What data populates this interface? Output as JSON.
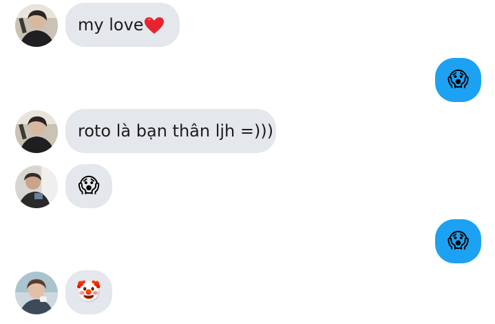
{
  "messages": [
    {
      "sender": "them",
      "text": "my love",
      "emoji_name": "red-heart"
    },
    {
      "sender": "me",
      "emoji": "😱",
      "emoji_name": "screaming-face"
    },
    {
      "sender": "them",
      "text": "roto là bạn thân ljh =)))"
    },
    {
      "sender": "them",
      "emoji": "😱",
      "emoji_name": "screaming-face"
    },
    {
      "sender": "me",
      "emoji": "😱",
      "emoji_name": "screaming-face"
    },
    {
      "sender": "them",
      "emoji": "🤡",
      "emoji_name": "clown-face"
    }
  ],
  "colors": {
    "incoming_bubble": "#e4e7eb",
    "outgoing_bubble": "#1da1f2",
    "text": "#1c1c1c",
    "heart": "#e8232f"
  }
}
